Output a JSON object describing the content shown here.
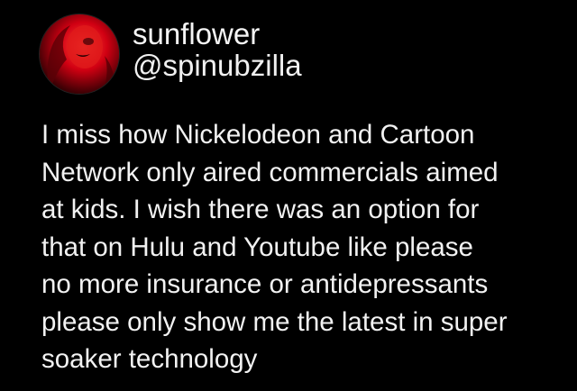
{
  "tweet": {
    "author": {
      "display_name": "sunflower",
      "handle": "@spinubzilla",
      "avatar": "red-tinted-portrait"
    },
    "text_lines": [
      "I miss how Nickelodeon and Cartoon",
      "Network only aired commercials aimed",
      "at kids. I wish there was an option for",
      "that on Hulu and Youtube like please",
      "no more insurance or antidepressants",
      "please only show me the latest in super",
      "soaker technology"
    ]
  },
  "colors": {
    "background": "#000000",
    "text": "#f2f2f2",
    "avatar_accent": "#c4000f"
  }
}
